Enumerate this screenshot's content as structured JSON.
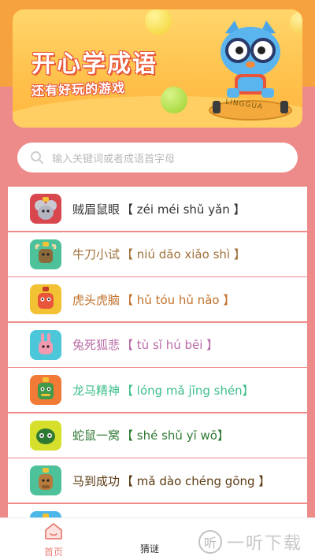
{
  "banner": {
    "title": "开心学成语",
    "subtitle": "还有好玩的游戏",
    "skateboard_text": "LINGGUA"
  },
  "search": {
    "placeholder": "输入关键词或者成语首字母",
    "icon": "search-icon"
  },
  "idioms": [
    {
      "word": "贼眉鼠眼",
      "pinyin": "【 zéi méi shǔ yǎn 】",
      "color": "#333333",
      "icon_bg": "#d9474e",
      "icon": "mouse-icon"
    },
    {
      "word": "牛刀小试",
      "pinyin": "【 niú dāo xiǎo shì 】",
      "color": "#a0703a",
      "icon_bg": "#4dc29a",
      "icon": "ox-icon"
    },
    {
      "word": "虎头虎脑",
      "pinyin": "【 hǔ tóu hǔ nǎo 】",
      "color": "#c0722c",
      "icon_bg": "#f3c234",
      "icon": "tiger-icon"
    },
    {
      "word": "兔死狐悲",
      "pinyin": "【 tù sǐ hú bēi 】",
      "color": "#b96aa6",
      "icon_bg": "#4cc6d9",
      "icon": "rabbit-icon"
    },
    {
      "word": "龙马精神",
      "pinyin": "【 lóng mǎ jīng shén】",
      "color": "#3fbf8a",
      "icon_bg": "#f07a36",
      "icon": "dragon-icon"
    },
    {
      "word": "蛇鼠一窝",
      "pinyin": "【 shé shǔ yī wō】",
      "color": "#2f7a33",
      "icon_bg": "#d6df2b",
      "icon": "snake-icon"
    },
    {
      "word": "马到成功",
      "pinyin": "【 mǎ dào chéng gōng 】",
      "color": "#5a3a10",
      "icon_bg": "#4dc29a",
      "icon": "horse-icon"
    },
    {
      "word": "",
      "pinyin": "",
      "color": "#333333",
      "icon_bg": "#4cb6e8",
      "icon": "goat-icon"
    }
  ],
  "tabs": [
    {
      "label": "首页",
      "icon": "home-icon",
      "active": true
    },
    {
      "label": "猜谜",
      "icon": "",
      "active": false
    }
  ],
  "watermark": {
    "logo": "听",
    "text": "一听下载"
  }
}
